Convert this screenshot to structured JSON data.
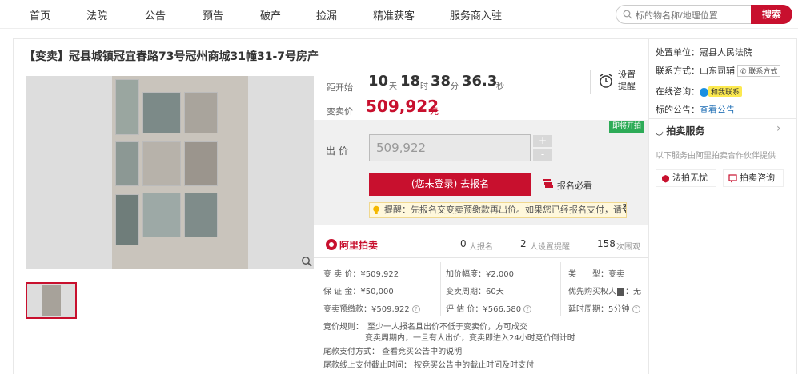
{
  "nav": {
    "items": [
      "首页",
      "法院",
      "公告",
      "预告",
      "破产",
      "捡漏",
      "精准获客",
      "服务商入驻"
    ],
    "search_placeholder": "标的物名称/地理位置",
    "search_button": "搜索"
  },
  "item": {
    "title": "【变卖】冠县城镇冠宜春路73号冠州商城31幢31-7号房产"
  },
  "countdown": {
    "label": "距开始",
    "days": "10",
    "days_unit": "天",
    "hours": "18",
    "hours_unit": "时",
    "minutes": "38",
    "minutes_unit": "分",
    "seconds": "36.3",
    "seconds_unit": "秒",
    "remind_label": "设置提醒"
  },
  "price": {
    "label": "变卖价",
    "value": "509,922",
    "unit": "元"
  },
  "bid": {
    "badge": "即将开拍",
    "label": "出 价",
    "input_value": "509,922",
    "plus": "+",
    "minus": "-",
    "register_button": "(您未登录) 去报名",
    "must_read": "报名必看",
    "tip_text": "提醒：先报名交变卖预缴款再出价。如果您已经报名支付，请",
    "tip_link": "登录"
  },
  "stats": {
    "brand": "阿里拍卖",
    "registered_num": "0",
    "registered_label": "人报名",
    "remind_num": "2",
    "remind_label": "人设置提醒",
    "views_num": "158",
    "views_label": "次围观"
  },
  "info": {
    "sale_price": "变 卖 价：¥509,922",
    "increment": "加价幅度：¥2,000",
    "type_label": "类　　型：",
    "type_val": "变卖",
    "deposit": "保 证 金：¥50,000",
    "period": "变卖周期：60天",
    "priority": "优先购买权人",
    "priority_val": "：无",
    "prepay": "变卖预缴款：¥509,922",
    "appraisal": "评 估 价：¥566,580",
    "delay": "延时周期：5分钟",
    "rule1": "竞价规则：　至少一人报名且出价不低于变卖价，方可成交",
    "rule2": "变卖周期内，一旦有人出价，变卖即进入24小时竞价倒计时",
    "tail_pay": "尾款支付方式：  查看竞买公告中的说明",
    "tail_deadline": "尾款线上支付截止时间：  按竞买公告中的截止时间及时支付"
  },
  "right": {
    "court_label": "处置单位：",
    "court": "冠县人民法院",
    "contact_label": "联系方式：",
    "contact": "山东司辅",
    "contact_tag": "联系方式",
    "consult_label": "在线咨询：",
    "consult_tag": "和我联系",
    "notice_label": "标的公告：",
    "notice_link": "查看公告",
    "service_title": "拍卖服务",
    "service_desc": "以下服务由阿里拍卖合作伙伴提供",
    "svc1": "法拍无忧",
    "svc2": "拍卖咨询"
  },
  "colors": {
    "brand_red": "#c8102e",
    "link_blue": "#1a6bb3",
    "badge_green": "#2dab57"
  }
}
